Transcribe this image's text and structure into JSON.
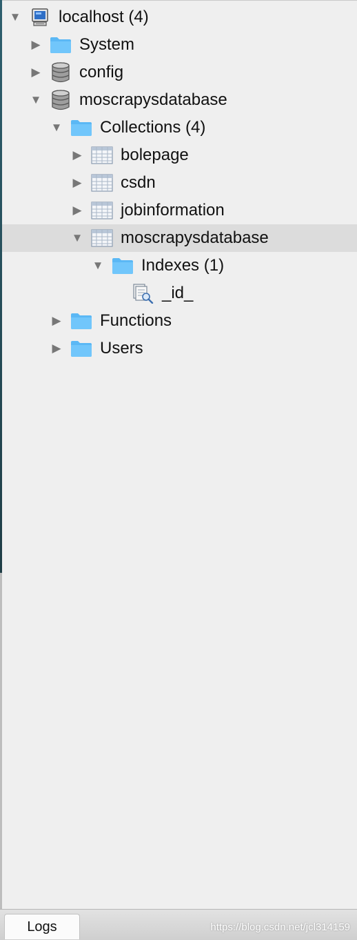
{
  "tree": [
    {
      "label": "localhost (4)",
      "icon": "server-icon",
      "expanded": true,
      "level": 0
    },
    {
      "label": "System",
      "icon": "folder-icon",
      "expanded": false,
      "level": 1
    },
    {
      "label": "config",
      "icon": "database-icon",
      "expanded": false,
      "level": 1
    },
    {
      "label": "moscrapysdatabase",
      "icon": "database-icon",
      "expanded": true,
      "level": 1
    },
    {
      "label": "Collections (4)",
      "icon": "folder-icon",
      "expanded": true,
      "level": 2
    },
    {
      "label": "bolepage",
      "icon": "collection-table-icon",
      "expanded": false,
      "level": 3
    },
    {
      "label": "csdn",
      "icon": "collection-table-icon",
      "expanded": false,
      "level": 3
    },
    {
      "label": "jobinformation",
      "icon": "collection-table-icon",
      "expanded": false,
      "level": 3
    },
    {
      "label": "moscrapysdatabase",
      "icon": "collection-table-icon",
      "expanded": true,
      "level": 3,
      "selected": true
    },
    {
      "label": "Indexes (1)",
      "icon": "folder-icon",
      "expanded": true,
      "level": 4
    },
    {
      "label": "_id_",
      "icon": "index-icon",
      "level": 5
    },
    {
      "label": "Functions",
      "icon": "folder-icon",
      "expanded": false,
      "level": 2
    },
    {
      "label": "Users",
      "icon": "folder-icon",
      "expanded": false,
      "level": 2
    }
  ],
  "bottom": {
    "logs_tab": "Logs",
    "watermark": "https://blog.csdn.net/jcl314159"
  },
  "colors": {
    "background": "#efefef",
    "selected_row": "#dcdcdc",
    "folder": "#5bb8f5"
  }
}
